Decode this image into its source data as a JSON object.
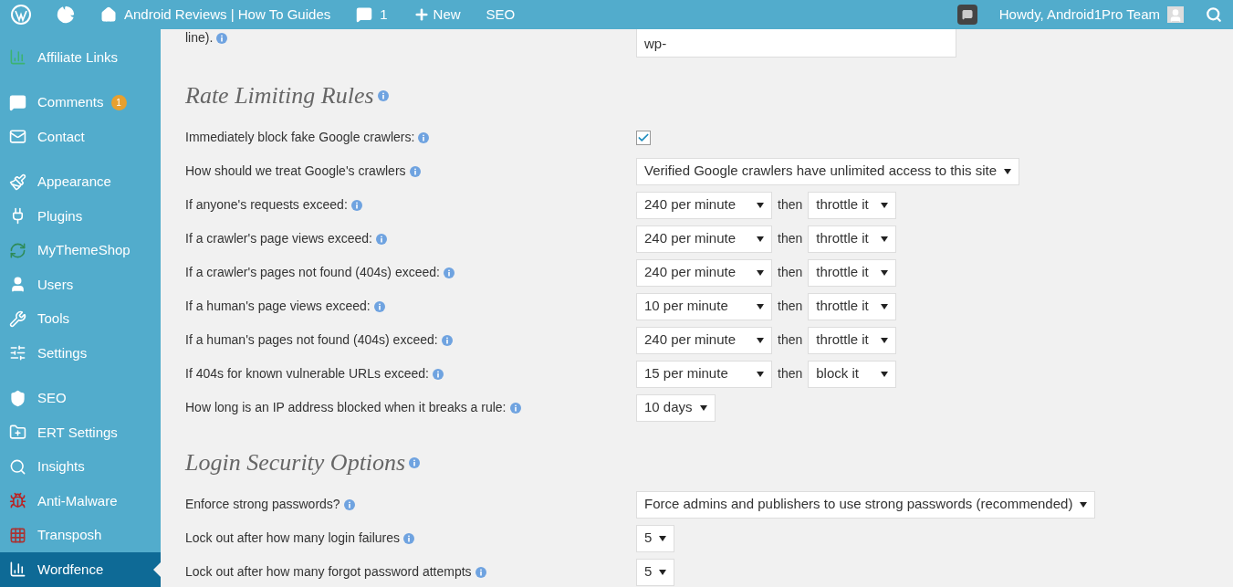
{
  "admin_bar": {
    "items": [
      {
        "kind": "logo"
      },
      {
        "kind": "stats"
      },
      {
        "kind": "home",
        "label": "Android Reviews | How To Guides"
      },
      {
        "kind": "comments",
        "label": "1"
      },
      {
        "kind": "new",
        "label": "New"
      },
      {
        "kind": "text",
        "label": "SEO"
      }
    ],
    "account": {
      "greeting": "Howdy, Android1Pro Team"
    }
  },
  "sidebar": {
    "groups": [
      [
        {
          "label": "Affiliate Links",
          "selected": false
        }
      ],
      [
        {
          "label": "Comments",
          "badge": "1",
          "selected": false
        },
        {
          "label": "Contact",
          "selected": false
        }
      ],
      [
        {
          "label": "Appearance",
          "selected": false
        },
        {
          "label": "Plugins",
          "selected": false
        },
        {
          "label": "MyThemeShop",
          "selected": false
        },
        {
          "label": "Users",
          "selected": false
        },
        {
          "label": "Tools",
          "selected": false
        },
        {
          "label": "Settings",
          "selected": false
        }
      ],
      [
        {
          "label": "SEO",
          "selected": false
        },
        {
          "label": "ERT Settings",
          "selected": false
        },
        {
          "label": "Insights",
          "selected": false
        },
        {
          "label": "Anti-Malware",
          "selected": false
        },
        {
          "label": "Transposh",
          "selected": false
        },
        {
          "label": "Wordfence",
          "selected": true
        }
      ]
    ]
  },
  "top_fragment": {
    "label": "line).",
    "textarea_value": "wp-"
  },
  "sections": [
    {
      "title": "Rate Limiting Rules",
      "rows": [
        {
          "kind": "checkbox",
          "label": "Immediately block fake Google crawlers:",
          "checked": true
        },
        {
          "kind": "select",
          "label": "How should we treat Google's crawlers",
          "value": "Verified Google crawlers have unlimited access to this site"
        },
        {
          "kind": "rate",
          "label": "If anyone's requests exceed:",
          "value": "240 per minute",
          "then": "then",
          "action": "throttle it"
        },
        {
          "kind": "rate",
          "label": "If a crawler's page views exceed:",
          "value": "240 per minute",
          "then": "then",
          "action": "throttle it"
        },
        {
          "kind": "rate",
          "label": "If a crawler's pages not found (404s) exceed:",
          "value": "240 per minute",
          "then": "then",
          "action": "throttle it"
        },
        {
          "kind": "rate",
          "label": "If a human's page views exceed:",
          "value": "10 per minute",
          "then": "then",
          "action": "throttle it"
        },
        {
          "kind": "rate",
          "label": "If a human's pages not found (404s) exceed:",
          "value": "240 per minute",
          "then": "then",
          "action": "throttle it"
        },
        {
          "kind": "rate",
          "label": "If 404s for known vulnerable URLs exceed:",
          "value": "15 per minute",
          "then": "then",
          "action": "block it"
        },
        {
          "kind": "select",
          "label": "How long is an IP address blocked when it breaks a rule:",
          "value": "10 days"
        }
      ]
    },
    {
      "title": "Login Security Options",
      "rows": [
        {
          "kind": "select",
          "label": "Enforce strong passwords?",
          "value": "Force admins and publishers to use strong passwords (recommended)"
        },
        {
          "kind": "select",
          "label": "Lock out after how many login failures",
          "value": "5"
        },
        {
          "kind": "select",
          "label": "Lock out after how many forgot password attempts",
          "value": "5"
        }
      ]
    }
  ]
}
